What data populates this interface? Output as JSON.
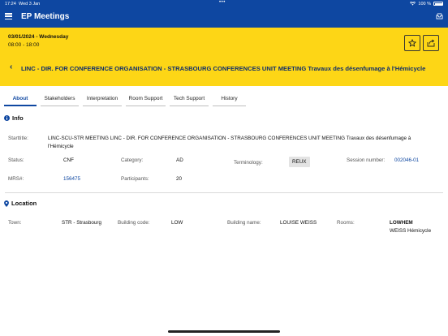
{
  "status_bar": {
    "time": "17:24",
    "date": "Wed 3 Jan",
    "battery": "100 %"
  },
  "nav": {
    "title": "EP Meetings",
    "menu_icon": "hamburger-icon",
    "inbox_icon": "inbox-icon"
  },
  "meeting": {
    "date": "03/01/2024 - Wednesday",
    "time": "08:00 - 18:00",
    "title": "LINC - DIR. FOR CONFERENCE ORGANISATION - STRASBOURG CONFERENCES UNIT MEETING Travaux des désenfumage à l'Hémicycle"
  },
  "tabs": [
    {
      "label": "About"
    },
    {
      "label": "Stakeholders"
    },
    {
      "label": "Interpretation"
    },
    {
      "label": "Room Support"
    },
    {
      "label": "Tech Support"
    },
    {
      "label": "History"
    }
  ],
  "info": {
    "title": "Info",
    "starttitle_label": "Starttitle:",
    "starttitle_line1": "LINC-SCU-STR MEETING LINC - DIR. FOR CONFERENCE ORGANISATION - STRASBOURG CONFERENCES UNIT MEETING Travaux des désenfumage à",
    "starttitle_line2": "l'Hémicycle",
    "status_label": "Status:",
    "status": "CNF",
    "category_label": "Category:",
    "category": "AD",
    "terminology_label": "Terminology:",
    "terminology": "REUX",
    "session_label": "Session number:",
    "session": "002046-01",
    "mrs_label": "MRS#:",
    "mrs": "156475",
    "participants_label": "Participants:",
    "participants": "20"
  },
  "location": {
    "title": "Location",
    "town_label": "Town:",
    "town": "STR - Strasbourg",
    "building_code_label": "Building code:",
    "building_code": "LOW",
    "building_name_label": "Building name:",
    "building_name": "LOUISE WEISS",
    "rooms_label": "Rooms:",
    "room_code": "LOWHEM",
    "room_name": "WEISS Hémicycle"
  },
  "colors": {
    "primary": "#0e47a1",
    "banner": "#fdd616",
    "title_text": "#0e2d6b"
  }
}
